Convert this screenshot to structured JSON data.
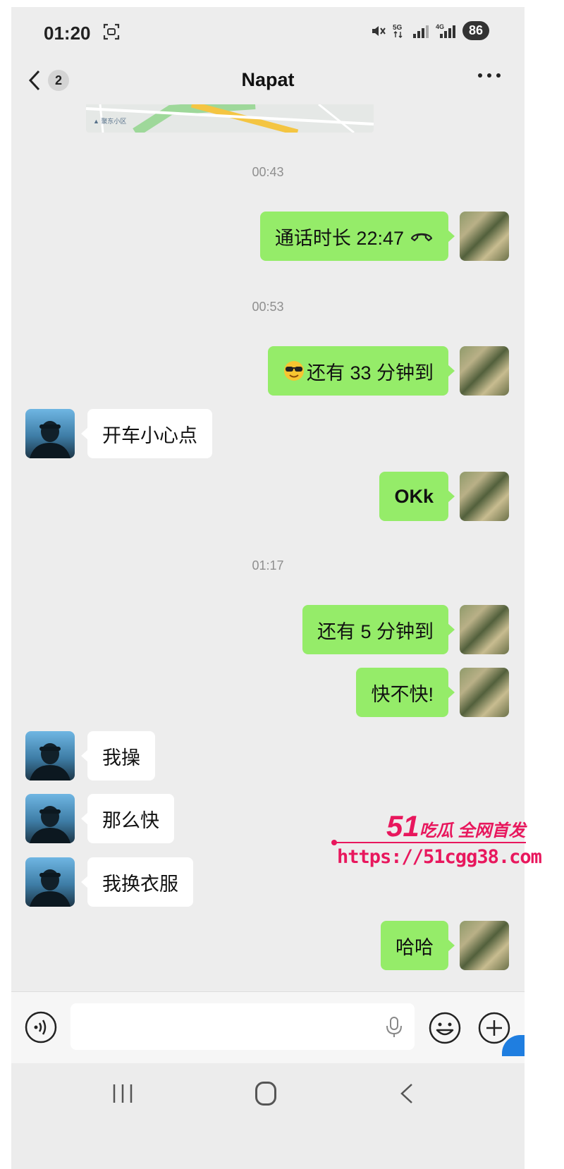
{
  "status_bar": {
    "time": "01:20",
    "battery": "86",
    "icons": [
      "screen-capture-icon",
      "mute-vibrate-icon",
      "5g-icon",
      "signal-icon",
      "4g-signal-icon",
      "battery-icon"
    ],
    "network_label": "5G",
    "network_label_2": "4G"
  },
  "nav": {
    "back_count": "2",
    "title": "Napat",
    "more": "more-icon"
  },
  "map_fragment": {
    "label": "▲ 聚东小区"
  },
  "timestamps": [
    "00:43",
    "00:53",
    "01:17"
  ],
  "messages": [
    {
      "side": "sent",
      "text": "通话时长 22:47",
      "icon": "phone-hangup-icon"
    },
    {
      "side": "sent",
      "text": "还有 33 分钟到",
      "icon": "sunglasses-emoji"
    },
    {
      "side": "recv",
      "text": "开车小心点"
    },
    {
      "side": "sent",
      "text": "OKk"
    },
    {
      "side": "sent",
      "text": "还有 5 分钟到"
    },
    {
      "side": "sent",
      "text": "快不快!"
    },
    {
      "side": "recv",
      "text": "我操"
    },
    {
      "side": "recv",
      "text": "那么快"
    },
    {
      "side": "recv",
      "text": "我换衣服"
    },
    {
      "side": "sent",
      "text": "哈哈"
    }
  ],
  "watermark": {
    "number": "51",
    "slogan": "吃瓜 全网首发",
    "url": "https://51cgg38.com"
  },
  "colors": {
    "chat_background": "#ededed",
    "sent_bubble": "#95ec69",
    "recv_bubble": "#ffffff",
    "watermark": "#e8175d"
  },
  "input_bar": {
    "voice": "voice-icon",
    "mic": "mic-icon",
    "emoji": "emoji-icon",
    "plus": "plus-icon"
  },
  "system_nav": [
    "recents-icon",
    "home-icon",
    "back-icon"
  ]
}
